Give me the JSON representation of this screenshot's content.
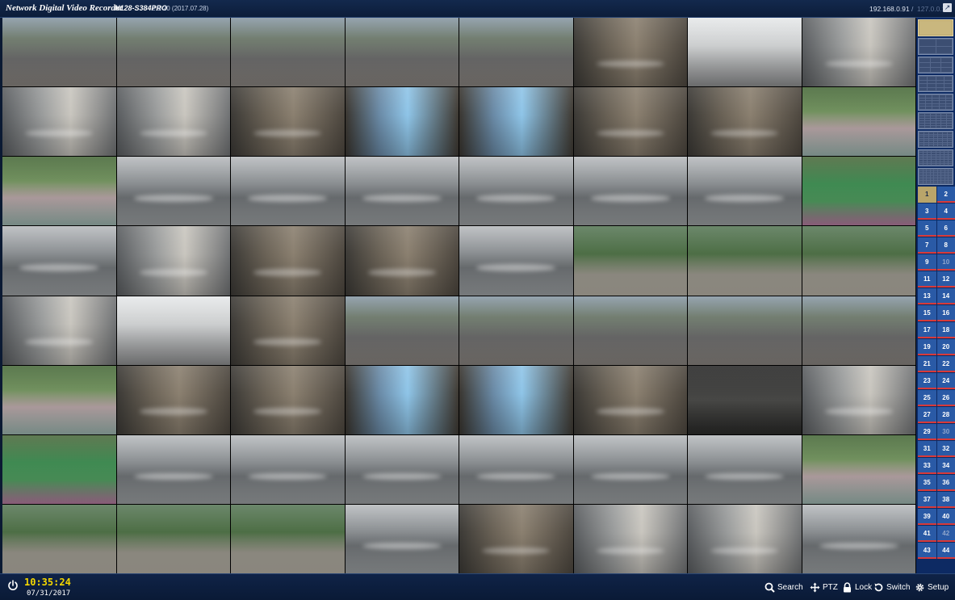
{
  "titlebar": {
    "app_title": "Network Digital Video Recorder",
    "model": "N128-S384PRO",
    "version": "2.9-20 (2017.07.28)",
    "ip_main": "192.168.0.91",
    "ip_separator": "/",
    "ip_secondary": "127.0.0.1"
  },
  "camera_tiles": [
    "street",
    "parking-lot",
    "street",
    "street",
    "street",
    "elevator",
    "gym",
    "lobby",
    "lobby",
    "lobby",
    "elevator",
    "elevator-blue",
    "elevator-blue",
    "elevator",
    "elevator",
    "playground",
    "playground",
    "parking",
    "parking",
    "parking",
    "parking",
    "parking",
    "parking",
    "tennis",
    "parking",
    "lobby",
    "elevator",
    "elevator",
    "parking",
    "garden",
    "garden",
    "garden",
    "lobby",
    "gym",
    "elevator",
    "street",
    "street",
    "street",
    "street",
    "street",
    "playground",
    "elevator",
    "elevator",
    "elevator-blue",
    "elevator-blue",
    "elevator",
    "dark",
    "lobby",
    "tennis",
    "parking",
    "parking",
    "parking",
    "parking",
    "parking",
    "parking",
    "playground",
    "garden",
    "garden",
    "garden",
    "parking",
    "elevator",
    "lobby",
    "lobby",
    "parking"
  ],
  "layouts": [
    {
      "name": "1x1",
      "n": 1,
      "active": true
    },
    {
      "name": "2x2",
      "n": 2
    },
    {
      "name": "3x3",
      "n": 3
    },
    {
      "name": "4x4",
      "n": 4
    },
    {
      "name": "5x5",
      "n": 5
    },
    {
      "name": "6x6",
      "n": 6
    },
    {
      "name": "7x7",
      "n": 7
    },
    {
      "name": "8x8",
      "n": 8
    },
    {
      "name": "9x9",
      "n": 9
    }
  ],
  "cameras": [
    "1",
    "2",
    "3",
    "4",
    "5",
    "6",
    "7",
    "8",
    "9",
    "10",
    "11",
    "12",
    "13",
    "14",
    "15",
    "16",
    "17",
    "18",
    "19",
    "20",
    "21",
    "22",
    "23",
    "24",
    "25",
    "26",
    "27",
    "28",
    "29",
    "30",
    "31",
    "32",
    "33",
    "34",
    "35",
    "36",
    "37",
    "38",
    "39",
    "40",
    "41",
    "42",
    "43",
    "44"
  ],
  "selected_camera": "1",
  "dim_cameras": [
    "10",
    "30",
    "42"
  ],
  "clock": {
    "time": "10:35:24",
    "date": "07/31/2017"
  },
  "bottom_buttons": {
    "search": "Search",
    "ptz": "PTZ",
    "lock": "Lock",
    "switch": "Switch",
    "setup": "Setup"
  },
  "colors": {
    "accent_yellow": "#f5d800",
    "panel_blue": "#0d2a63",
    "camera_button": "#2a5aa6",
    "selected": "#b9a56a",
    "record_red": "#d83a3a"
  }
}
